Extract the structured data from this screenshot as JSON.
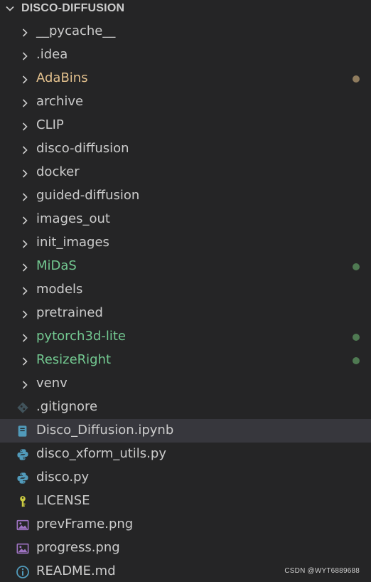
{
  "explorer": {
    "folder_title": "DISCO-DIFFUSION",
    "colors": {
      "default_text": "#cccccc",
      "modified_text": "#e2c08d",
      "modified_dot": "#8f7c5e",
      "untracked_text": "#73c991",
      "untracked_dot": "#4f7a52",
      "selected_bg": "#37373d"
    },
    "folders": [
      {
        "label": "__pycache__",
        "status": "none"
      },
      {
        "label": ".idea",
        "status": "none"
      },
      {
        "label": "AdaBins",
        "status": "modified"
      },
      {
        "label": "archive",
        "status": "none"
      },
      {
        "label": "CLIP",
        "status": "none"
      },
      {
        "label": "disco-diffusion",
        "status": "none"
      },
      {
        "label": "docker",
        "status": "none"
      },
      {
        "label": "guided-diffusion",
        "status": "none"
      },
      {
        "label": "images_out",
        "status": "none"
      },
      {
        "label": "init_images",
        "status": "none"
      },
      {
        "label": "MiDaS",
        "status": "untracked"
      },
      {
        "label": "models",
        "status": "none"
      },
      {
        "label": "pretrained",
        "status": "none"
      },
      {
        "label": "pytorch3d-lite",
        "status": "untracked"
      },
      {
        "label": "ResizeRight",
        "status": "untracked"
      },
      {
        "label": "venv",
        "status": "none"
      }
    ],
    "files": [
      {
        "label": ".gitignore",
        "icon": "git-icon"
      },
      {
        "label": "Disco_Diffusion.ipynb",
        "icon": "notebook-icon",
        "selected": true
      },
      {
        "label": "disco_xform_utils.py",
        "icon": "python-icon"
      },
      {
        "label": "disco.py",
        "icon": "python-icon"
      },
      {
        "label": "LICENSE",
        "icon": "license-key-icon"
      },
      {
        "label": "prevFrame.png",
        "icon": "image-icon"
      },
      {
        "label": "progress.png",
        "icon": "image-icon"
      },
      {
        "label": "README.md",
        "icon": "info-icon"
      }
    ]
  },
  "watermark": "CSDN @WYT6889688"
}
